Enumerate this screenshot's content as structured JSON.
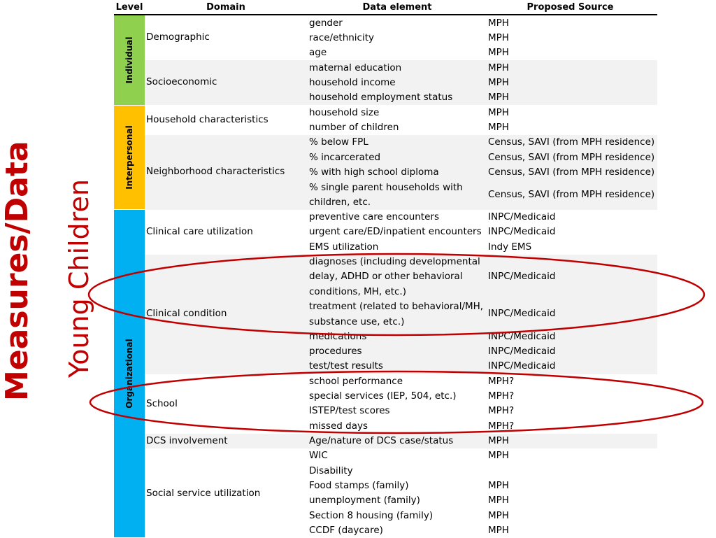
{
  "slide_title": {
    "line1": "Measures/Data",
    "line2": "Young Children"
  },
  "headers": {
    "level": "Level",
    "domain": "Domain",
    "element": "Data element",
    "source": "Proposed Source"
  },
  "levels": [
    {
      "label": "Individual",
      "color": "#8fd14f"
    },
    {
      "label": "Interpersonal",
      "color": "#ffc000"
    },
    {
      "label": "Organizational",
      "color": "#00b0f0"
    }
  ],
  "domains": [
    "Demographic",
    "Socioeconomic",
    "Household characteristics",
    "Neighborhood characteristics",
    "Clinical care utilization",
    "Clinical condition",
    "School",
    "DCS involvement",
    "Social service utilization"
  ],
  "rows": [
    {
      "element": "gender",
      "source": "MPH"
    },
    {
      "element": "race/ethnicity",
      "source": "MPH"
    },
    {
      "element": "age",
      "source": "MPH"
    },
    {
      "element": "maternal education",
      "source": "MPH"
    },
    {
      "element": "household income",
      "source": "MPH"
    },
    {
      "element": "household employment status",
      "source": "MPH"
    },
    {
      "element": "household size",
      "source": "MPH"
    },
    {
      "element": "number of children",
      "source": "MPH"
    },
    {
      "element": "% below FPL",
      "source": "Census, SAVI (from MPH residence)"
    },
    {
      "element": "% incarcerated",
      "source": "Census, SAVI (from MPH residence)"
    },
    {
      "element": "% with high school diploma",
      "source": "Census, SAVI (from MPH residence)"
    },
    {
      "element": "% single parent households with",
      "element2": "children, etc.",
      "source": "Census, SAVI (from MPH residence)"
    },
    {
      "element": "preventive care encounters",
      "source": "INPC/Medicaid"
    },
    {
      "element": "urgent care/ED/inpatient encounters",
      "source": "INPC/Medicaid"
    },
    {
      "element": "EMS utilization",
      "source": "Indy EMS"
    },
    {
      "element": "diagnoses (including developmental",
      "element2": "delay, ADHD or other behavioral",
      "element3": "conditions, MH, etc.)",
      "source": "INPC/Medicaid"
    },
    {
      "element": "treatment (related to behavioral/MH,",
      "element2": "substance use, etc.)",
      "source": "INPC/Medicaid"
    },
    {
      "element": "medications",
      "source": "INPC/Medicaid"
    },
    {
      "element": "procedures",
      "source": "INPC/Medicaid"
    },
    {
      "element": "test/test results",
      "source": "INPC/Medicaid"
    },
    {
      "element": "school performance",
      "source": "MPH?"
    },
    {
      "element": "special services (IEP, 504, etc.)",
      "source": "MPH?"
    },
    {
      "element": "ISTEP/test scores",
      "source": "MPH?"
    },
    {
      "element": "missed days",
      "source": "MPH?"
    },
    {
      "element": "Age/nature of DCS case/status",
      "source": "MPH"
    },
    {
      "element": "WIC",
      "source": "MPH"
    },
    {
      "element": "Disability",
      "source": ""
    },
    {
      "element": "Food stamps (family)",
      "source": "MPH"
    },
    {
      "element": "unemployment (family)",
      "source": "MPH"
    },
    {
      "element": "Section 8 housing (family)",
      "source": "MPH"
    },
    {
      "element": "CCDF (daycare)",
      "source": "MPH"
    }
  ],
  "annotation_color": "#c00000"
}
